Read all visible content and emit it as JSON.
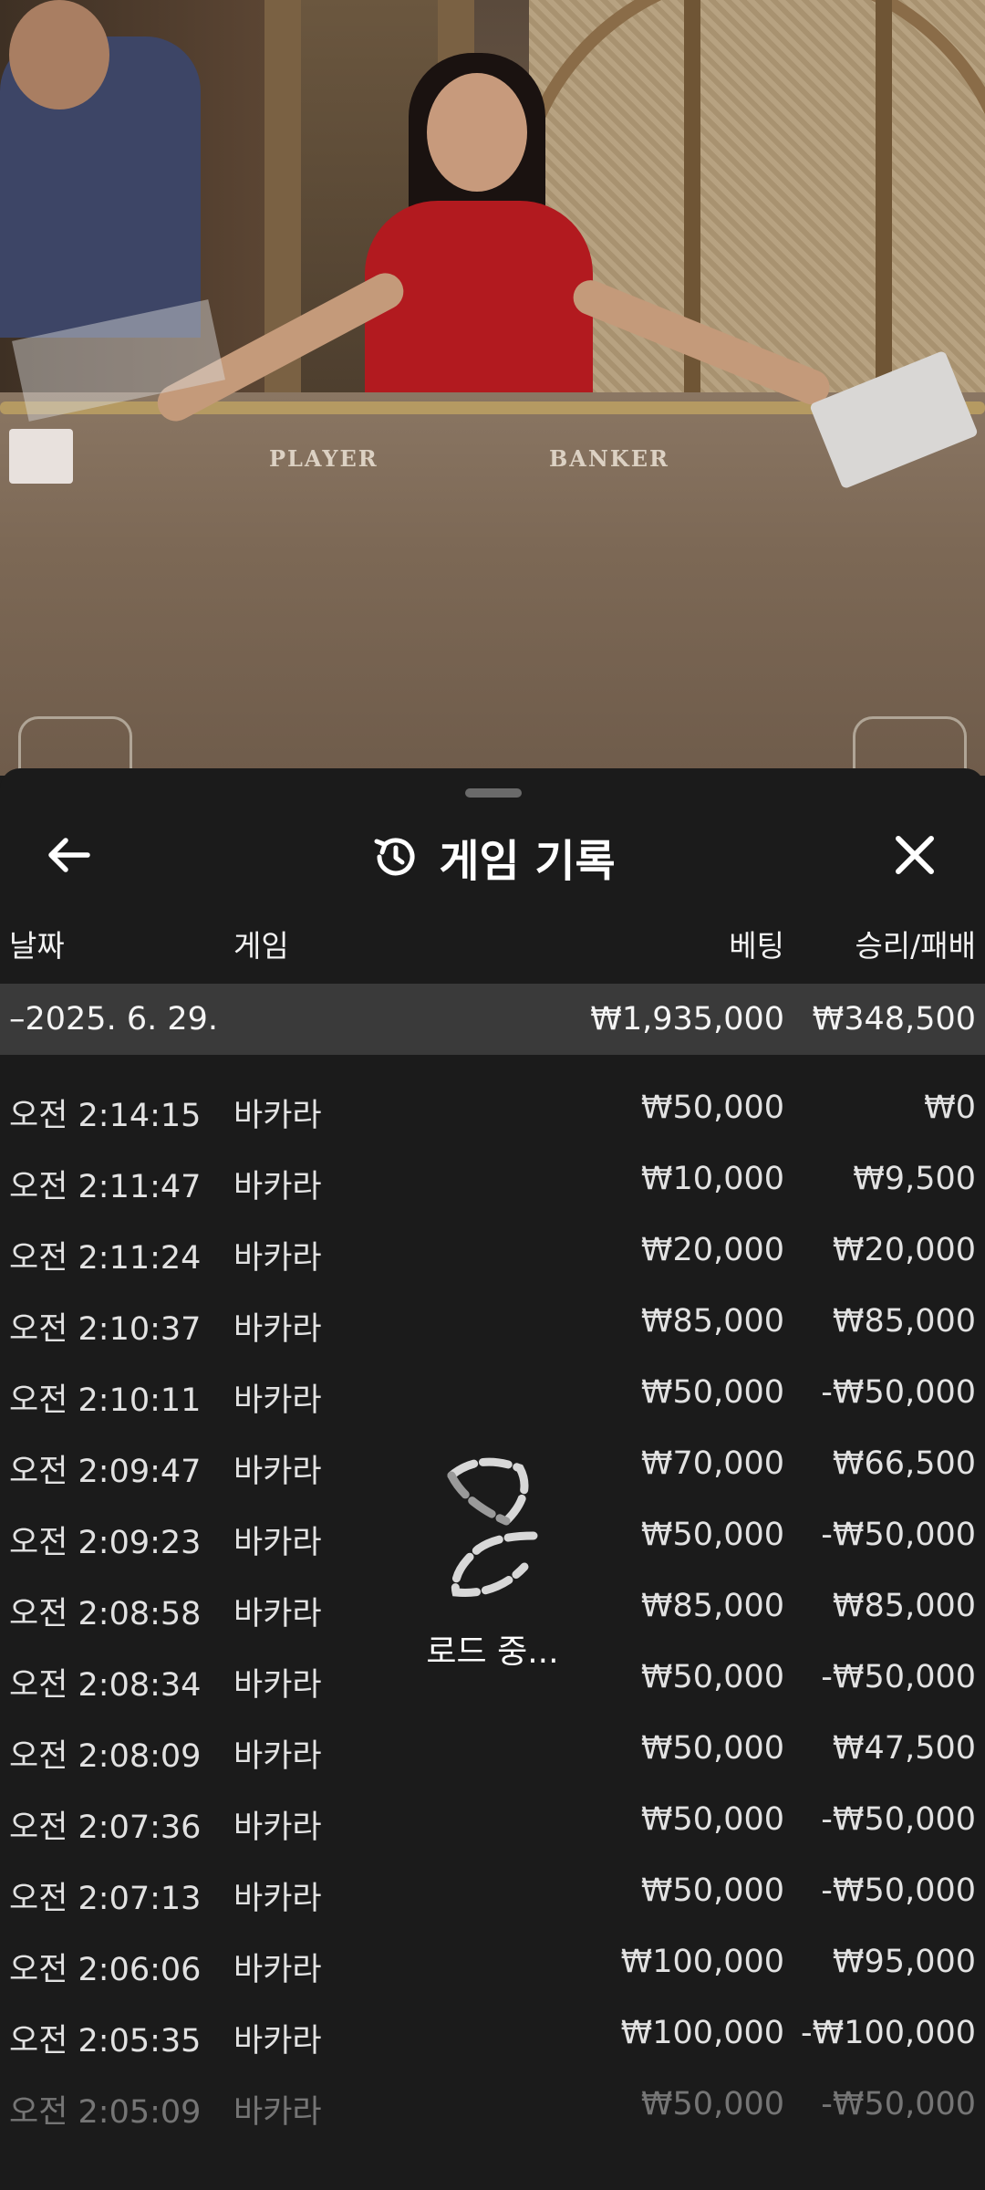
{
  "video": {
    "table_labels": {
      "player": "PLAYER",
      "banker": "BANKER"
    }
  },
  "sheet": {
    "title": "게임 기록",
    "icons": {
      "back": "arrow-left-icon",
      "history": "history-icon",
      "close": "close-icon"
    },
    "columns": {
      "date": "날짜",
      "game": "게임",
      "bet": "베팅",
      "win_loss": "승리/패배"
    },
    "summary": {
      "date": "–2025. 6. 29.",
      "bet": "₩1,935,000",
      "win_loss": "₩348,500"
    },
    "rows": [
      {
        "time": "오전 2:14:15",
        "game": "바카라",
        "bet": "₩50,000",
        "win_loss": "₩0"
      },
      {
        "time": "오전 2:11:47",
        "game": "바카라",
        "bet": "₩10,000",
        "win_loss": "₩9,500"
      },
      {
        "time": "오전 2:11:24",
        "game": "바카라",
        "bet": "₩20,000",
        "win_loss": "₩20,000"
      },
      {
        "time": "오전 2:10:37",
        "game": "바카라",
        "bet": "₩85,000",
        "win_loss": "₩85,000"
      },
      {
        "time": "오전 2:10:11",
        "game": "바카라",
        "bet": "₩50,000",
        "win_loss": "-₩50,000"
      },
      {
        "time": "오전 2:09:47",
        "game": "바카라",
        "bet": "₩70,000",
        "win_loss": "₩66,500"
      },
      {
        "time": "오전 2:09:23",
        "game": "바카라",
        "bet": "₩50,000",
        "win_loss": "-₩50,000"
      },
      {
        "time": "오전 2:08:58",
        "game": "바카라",
        "bet": "₩85,000",
        "win_loss": "₩85,000"
      },
      {
        "time": "오전 2:08:34",
        "game": "바카라",
        "bet": "₩50,000",
        "win_loss": "-₩50,000"
      },
      {
        "time": "오전 2:08:09",
        "game": "바카라",
        "bet": "₩50,000",
        "win_loss": "₩47,500"
      },
      {
        "time": "오전 2:07:36",
        "game": "바카라",
        "bet": "₩50,000",
        "win_loss": "-₩50,000"
      },
      {
        "time": "오전 2:07:13",
        "game": "바카라",
        "bet": "₩50,000",
        "win_loss": "-₩50,000"
      },
      {
        "time": "오전 2:06:06",
        "game": "바카라",
        "bet": "₩100,000",
        "win_loss": "₩95,000"
      },
      {
        "time": "오전 2:05:35",
        "game": "바카라",
        "bet": "₩100,000",
        "win_loss": "-₩100,000"
      },
      {
        "time": "오전 2:05:09",
        "game": "바카라",
        "bet": "₩50,000",
        "win_loss": "-₩50,000"
      }
    ],
    "loading": {
      "icon": "loading-spinner-icon",
      "text": "로드 중..."
    }
  }
}
